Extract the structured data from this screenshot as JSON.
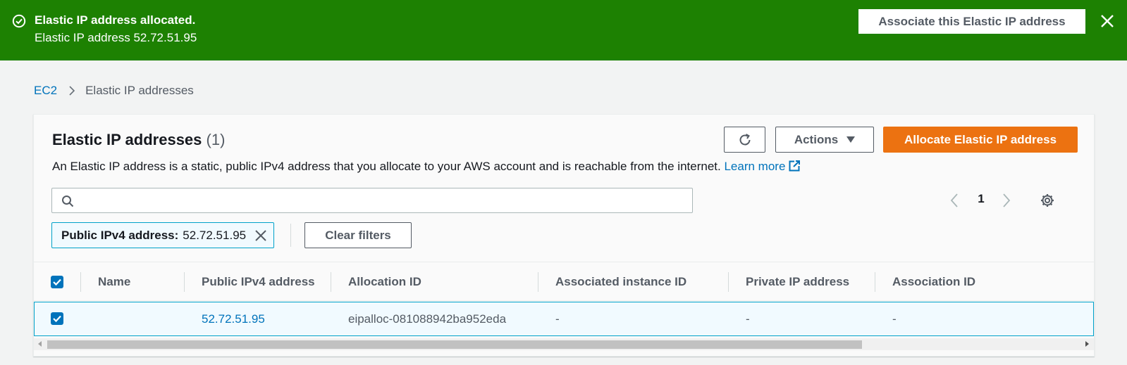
{
  "flash": {
    "title": "Elastic IP address allocated.",
    "subtitle": "Elastic IP address 52.72.51.95",
    "action_label": "Associate this Elastic IP address",
    "icon": "check-circle-icon",
    "close_icon": "close-icon",
    "bg_color": "#1d8102"
  },
  "breadcrumb": {
    "items": [
      "EC2",
      "Elastic IP addresses"
    ]
  },
  "header": {
    "title": "Elastic IP addresses",
    "count": "(1)",
    "description": "An Elastic IP address is a static, public IPv4 address that you allocate to your AWS account and is reachable from the internet.",
    "learn_more": "Learn more",
    "refresh_icon": "refresh-icon",
    "actions_label": "Actions",
    "primary_label": "Allocate Elastic IP address",
    "primary_color": "#ec7211"
  },
  "search": {
    "placeholder": "",
    "value": ""
  },
  "pagination": {
    "current_page": "1"
  },
  "filter": {
    "key": "Public IPv4 address:",
    "value": "52.72.51.95",
    "clear_label": "Clear filters"
  },
  "table": {
    "columns": [
      "Name",
      "Public IPv4 address",
      "Allocation ID",
      "Associated instance ID",
      "Private IP address",
      "Association ID"
    ],
    "rows": [
      {
        "selected": true,
        "name": "",
        "public_ip": "52.72.51.95",
        "allocation_id": "eipalloc-081088942ba952eda",
        "instance_id": "-",
        "private_ip": "-",
        "association_id": "-"
      }
    ]
  }
}
